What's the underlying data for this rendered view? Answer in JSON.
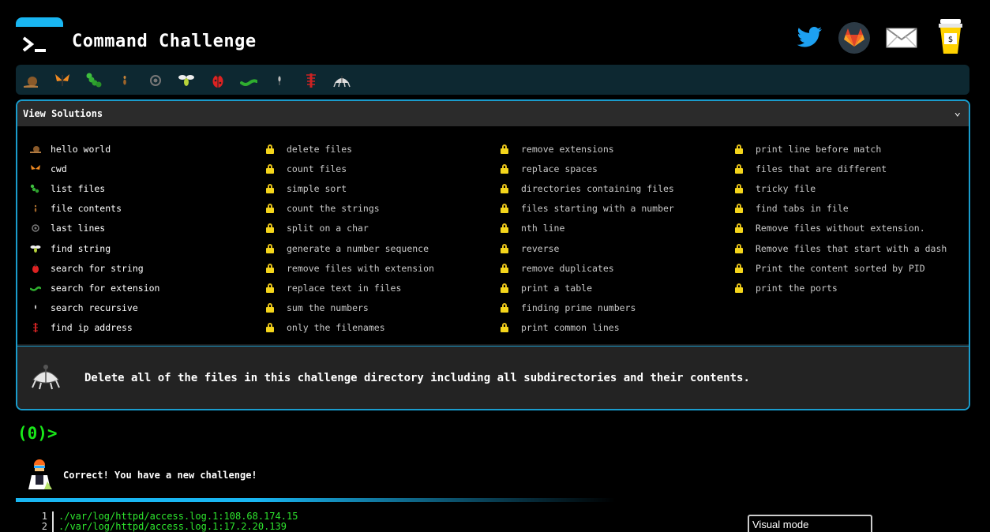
{
  "header": {
    "title": "Command Challenge",
    "icons": [
      "twitter-icon",
      "gitlab-icon",
      "mail-icon",
      "coffee-cup-icon"
    ]
  },
  "bugs": [
    "snail",
    "butterfly",
    "caterpillar",
    "ant",
    "beetle-round",
    "fly",
    "ladybug",
    "worm",
    "mosquito",
    "centipede",
    "cockroach"
  ],
  "solutions": {
    "header": "View Solutions",
    "columns": [
      [
        {
          "label": "hello world",
          "icon": "snail",
          "locked": false
        },
        {
          "label": "cwd",
          "icon": "butterfly",
          "locked": false
        },
        {
          "label": "list files",
          "icon": "caterpillar",
          "locked": false
        },
        {
          "label": "file contents",
          "icon": "ant",
          "locked": false
        },
        {
          "label": "last lines",
          "icon": "beetle-round",
          "locked": false
        },
        {
          "label": "find string",
          "icon": "fly",
          "locked": false
        },
        {
          "label": "search for string",
          "icon": "ladybug",
          "locked": false
        },
        {
          "label": "search for extension",
          "icon": "worm",
          "locked": false
        },
        {
          "label": "search recursive",
          "icon": "mosquito",
          "locked": false
        },
        {
          "label": "find ip address",
          "icon": "centipede",
          "locked": false
        }
      ],
      [
        {
          "label": "delete files",
          "locked": true
        },
        {
          "label": "count files",
          "locked": true
        },
        {
          "label": "simple sort",
          "locked": true
        },
        {
          "label": "count the strings",
          "locked": true
        },
        {
          "label": "split on a char",
          "locked": true
        },
        {
          "label": "generate a number sequence",
          "locked": true
        },
        {
          "label": "remove files with extension",
          "locked": true
        },
        {
          "label": "replace text in files",
          "locked": true
        },
        {
          "label": "sum the numbers",
          "locked": true
        },
        {
          "label": "only the filenames",
          "locked": true
        }
      ],
      [
        {
          "label": "remove extensions",
          "locked": true
        },
        {
          "label": "replace spaces",
          "locked": true
        },
        {
          "label": "directories containing files",
          "locked": true
        },
        {
          "label": "files starting with a number",
          "locked": true
        },
        {
          "label": "nth line",
          "locked": true
        },
        {
          "label": "reverse",
          "locked": true
        },
        {
          "label": "remove duplicates",
          "locked": true
        },
        {
          "label": "print a table",
          "locked": true
        },
        {
          "label": "finding prime numbers",
          "locked": true
        },
        {
          "label": "print common lines",
          "locked": true
        }
      ],
      [
        {
          "label": "print line before match",
          "locked": true
        },
        {
          "label": "files that are different",
          "locked": true
        },
        {
          "label": "tricky file",
          "locked": true
        },
        {
          "label": "find tabs in file",
          "locked": true
        },
        {
          "label": "Remove files without extension.",
          "locked": true
        },
        {
          "label": "Remove files that start with a dash",
          "locked": true
        },
        {
          "label": "Print the content sorted by PID",
          "locked": true
        },
        {
          "label": "print the ports",
          "locked": true
        }
      ]
    ]
  },
  "challenge": {
    "text": "Delete all of the files in this challenge directory including all subdirectories and their contents.",
    "icon": "cockroach"
  },
  "prompt": "(0)>",
  "message": "Correct! You have a new challenge!",
  "output": [
    {
      "num": "1",
      "text": "./var/log/httpd/access.log.1:108.68.174.15"
    },
    {
      "num": "2",
      "text": "./var/log/httpd/access.log.1:17.2.20.139"
    }
  ],
  "visual_mode": "Visual mode",
  "colors": {
    "accent": "#19b6f2",
    "prompt_green": "#19e619",
    "lock_yellow": "#f4d51b"
  }
}
